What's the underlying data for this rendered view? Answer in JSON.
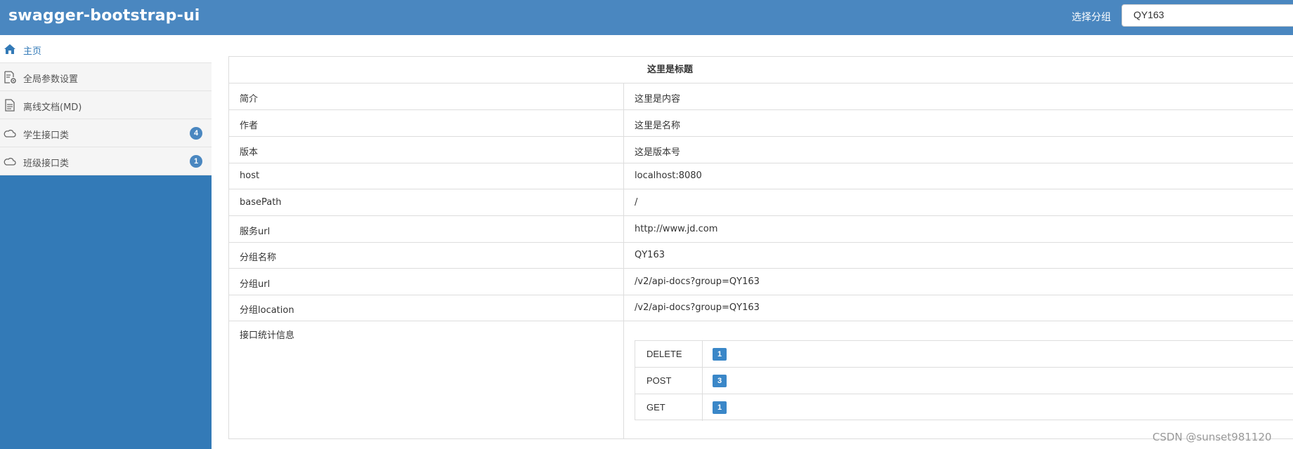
{
  "header": {
    "brand": "swagger-bootstrap-ui",
    "group_label": "选择分组",
    "group_value": "QY163",
    "colors": {
      "bar": "#4a87c0"
    }
  },
  "sidebar": {
    "items": [
      {
        "label": "主页",
        "icon": "home-icon",
        "active": true
      },
      {
        "label": "全局参数设置",
        "icon": "settings-doc-icon"
      },
      {
        "label": "离线文档(MD)",
        "icon": "document-icon"
      },
      {
        "label": "学生接口类",
        "icon": "cloud-icon",
        "badge": "4"
      },
      {
        "label": "班级接口类",
        "icon": "cloud-icon",
        "badge": "1"
      }
    ]
  },
  "main": {
    "title": "这里是标题",
    "rows": [
      {
        "key": "简介",
        "value": "这里是内容"
      },
      {
        "key": "作者",
        "value": "这里是名称"
      },
      {
        "key": "版本",
        "value": "这是版本号"
      },
      {
        "key": "host",
        "value": "localhost:8080"
      },
      {
        "key": "basePath",
        "value": "/"
      },
      {
        "key": "服务url",
        "value": "http://www.jd.com"
      },
      {
        "key": "分组名称",
        "value": "QY163"
      },
      {
        "key": "分组url",
        "value": "/v2/api-docs?group=QY163"
      },
      {
        "key": "分组location",
        "value": "/v2/api-docs?group=QY163"
      }
    ],
    "stats_label": "接口统计信息",
    "stats": [
      {
        "method": "DELETE",
        "count": "1"
      },
      {
        "method": "POST",
        "count": "3"
      },
      {
        "method": "GET",
        "count": "1"
      }
    ]
  },
  "watermark": "CSDN @sunset981120"
}
